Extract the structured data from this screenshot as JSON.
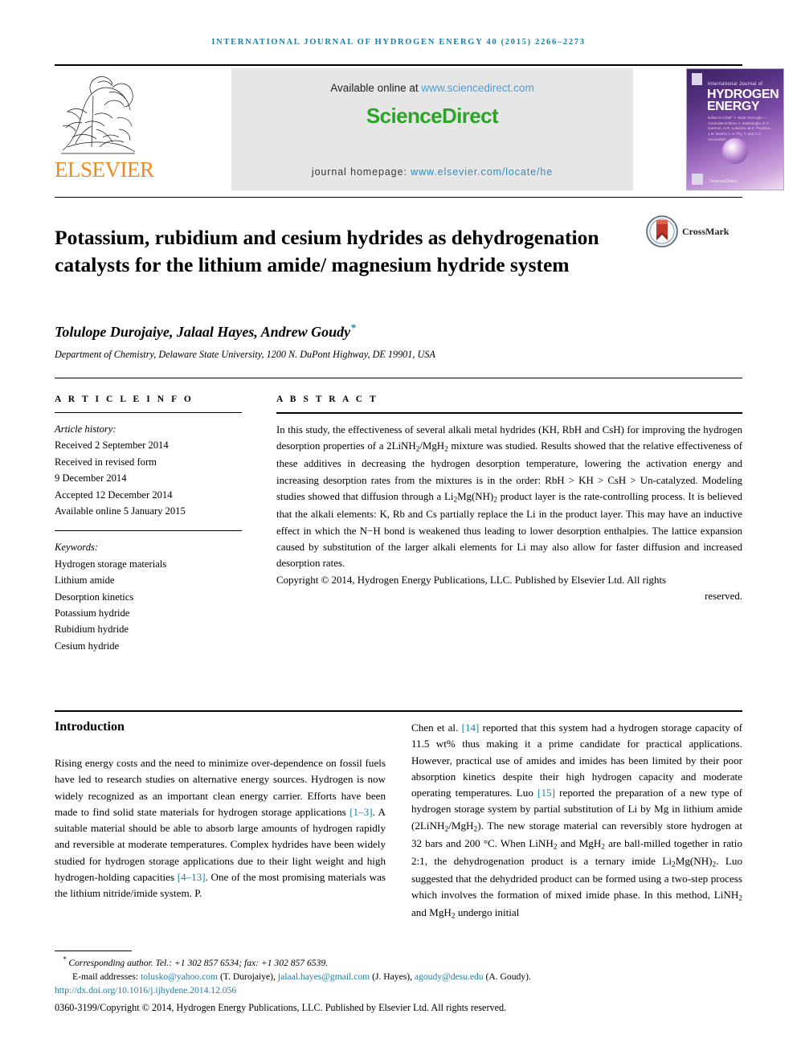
{
  "running_head": "International Journal of Hydrogen Energy 40 (2015) 2266–2273",
  "masthead": {
    "publisher_logo_text": "ELSEVIER",
    "available_online_prefix": "Available online at ",
    "available_online_link": "www.sciencedirect.com",
    "sciencedirect_logo": "ScienceDirect",
    "journal_homepage_prefix": "journal homepage: ",
    "journal_homepage_link": "www.elsevier.com/locate/he",
    "cover": {
      "sub": "International Journal of",
      "line1": "HYDROGEN",
      "line2": "ENERGY",
      "editors": "Editor-in-Chief: T. Nejat Veziroglu — Associate Editors: A. Bakkaloğlu, E.C. Gardner, H.R. Lukacha, M.Z. Peynkov, J.M. Bartho, L.V. Thy, T. and C.C. Vucinadale",
      "science_direct_mark": "ScienceDirect"
    }
  },
  "article": {
    "title": "Potassium, rubidium and cesium hydrides as dehydrogenation catalysts for the lithium amide/ magnesium hydride system",
    "crossmark_label": "CrossMark",
    "authors": "Tolulope Durojaiye, Jalaal Hayes, Andrew Goudy",
    "author_star": "*",
    "affiliation": "Department of Chemistry, Delaware State University, 1200 N. DuPont Highway, DE 19901, USA"
  },
  "article_info": {
    "heading": "A R T I C L E   I N F O",
    "history_label": "Article history:",
    "history": [
      "Received 2 September 2014",
      "Received in revised form",
      "9 December 2014",
      "Accepted 12 December 2014",
      "Available online 5 January 2015"
    ],
    "keywords_label": "Keywords:",
    "keywords": [
      "Hydrogen storage materials",
      "Lithium amide",
      "Desorption kinetics",
      "Potassium hydride",
      "Rubidium hydride",
      "Cesium hydride"
    ]
  },
  "abstract": {
    "heading": "A B S T R A C T",
    "body_html": "In this study, the effectiveness of several alkali metal hydrides (KH, RbH and CsH) for improving the hydrogen desorption properties of a 2LiNH<sub>2</sub>/MgH<sub>2</sub> mixture was studied. Results showed that the relative effectiveness of these additives in decreasing the hydrogen desorption temperature, lowering the activation energy and increasing desorption rates from the mixtures is in the order: RbH &gt; KH &gt; CsH &gt; Un-catalyzed. Modeling studies showed that diffusion through a Li<sub>2</sub>Mg(NH)<sub>2</sub> product layer is the rate-controlling process. It is believed that the alkali elements: K, Rb and Cs partially replace the Li in the product layer. This may have an inductive effect in which the N&#8722;H bond is weakened thus leading to lower desorption enthalpies. The lattice expansion caused by substitution of the larger alkali elements for Li may also allow for faster diffusion and increased desorption rates.",
    "copyright": "Copyright © 2014, Hydrogen Energy Publications, LLC. Published by Elsevier Ltd. All rights",
    "copyright_tail": "reserved."
  },
  "body": {
    "intro_heading": "Introduction",
    "left_html": "Rising energy costs and the need to minimize over-dependence on fossil fuels have led to research studies on alternative energy sources. Hydrogen is now widely recognized as an important clean energy carrier. Efforts have been made to find solid state materials for hydrogen storage applications <span class=\"ref\">[1–3]</span>. A suitable material should be able to absorb large amounts of hydrogen rapidly and reversible at moderate temperatures. Complex hydrides have been widely studied for hydrogen storage applications due to their light weight and high hydrogen-holding capacities <span class=\"ref\">[4–13]</span>. One of the most promising materials was the lithium nitride/imide system. P.",
    "right_html": "Chen et al. <span class=\"ref\">[14]</span> reported that this system had a hydrogen storage capacity of 11.5 wt% thus making it a prime candidate for practical applications. However, practical use of amides and imides has been limited by their poor absorption kinetics despite their high hydrogen capacity and moderate operating temperatures. Luo <span class=\"ref\">[15]</span> reported the preparation of a new type of hydrogen storage system by partial substitution of Li by Mg in lithium amide (2LiNH<sub>2</sub>/MgH<sub>2</sub>). The new storage material can reversibly store hydrogen at 32 bars and 200 °C. When LiNH<sub>2</sub> and MgH<sub>2</sub> are ball-milled together in ratio 2:1, the dehydrogenation product is a ternary imide Li<sub>2</sub>Mg(NH)<sub>2</sub>. Luo suggested that the dehydrided product can be formed using a two-step process which involves the formation of mixed imide phase. In this method, LiNH<sub>2</sub> and MgH<sub>2</sub> undergo initial"
  },
  "footer": {
    "corresponding": "Corresponding author. Tel.: +1 302 857 6534; fax: +1 302 857 6539.",
    "email_label": "E-mail addresses:",
    "emails": [
      {
        "address": "tolusko@yahoo.com",
        "name": "(T. Durojaiye),"
      },
      {
        "address": "jalaal.hayes@gmail.com",
        "name": "(J. Hayes),"
      },
      {
        "address": "agoudy@desu.edu",
        "name": "(A. Goudy)."
      }
    ],
    "doi": "http://dx.doi.org/10.1016/j.ijhydene.2014.12.056",
    "issn_copyright": "0360-3199/Copyright © 2014, Hydrogen Energy Publications, LLC. Published by Elsevier Ltd. All rights reserved."
  },
  "colors": {
    "link_blue": "#1a7fa8",
    "sciencedirect_green": "#2BA428",
    "elsevier_orange": "#ED8B20",
    "masthead_gray": "#e6e6e6"
  }
}
